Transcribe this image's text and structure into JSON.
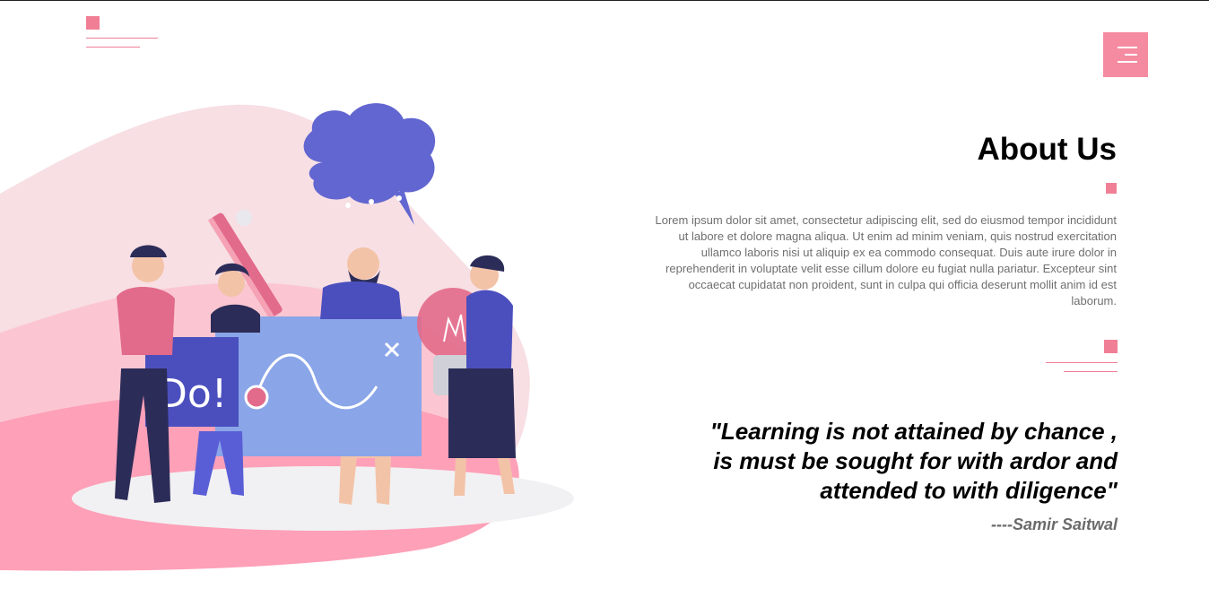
{
  "brand": {
    "accent": "#f07f96",
    "menu_bg": "#f58ba0"
  },
  "header": {
    "logo_icon": "logo-mark",
    "menu_icon": "hamburger-icon"
  },
  "social": [
    {
      "name": "facebook-icon"
    },
    {
      "name": "instagram-icon"
    },
    {
      "name": "twitter-icon"
    },
    {
      "name": "linkedin-icon"
    }
  ],
  "illustration": {
    "speech_bubble_dots": "• • •",
    "board_text": "Do!"
  },
  "about": {
    "title": "About Us",
    "body": "Lorem ipsum dolor sit amet, consectetur adipiscing elit, sed do eiusmod tempor incididunt ut labore et dolore magna aliqua. Ut enim ad minim veniam, quis nostrud exercitation ullamco laboris nisi ut aliquip ex ea commodo consequat. Duis aute irure dolor in reprehenderit in voluptate velit esse cillum dolore eu fugiat nulla pariatur. Excepteur sint occaecat cupidatat non proident, sunt in culpa qui officia deserunt mollit anim id est laborum."
  },
  "quote": {
    "line1": "\"Learning is not attained by chance ,",
    "line2": "is must be sought for with ardor and",
    "line3": "attended to with diligence\"",
    "author": "----Samir Saitwal"
  }
}
